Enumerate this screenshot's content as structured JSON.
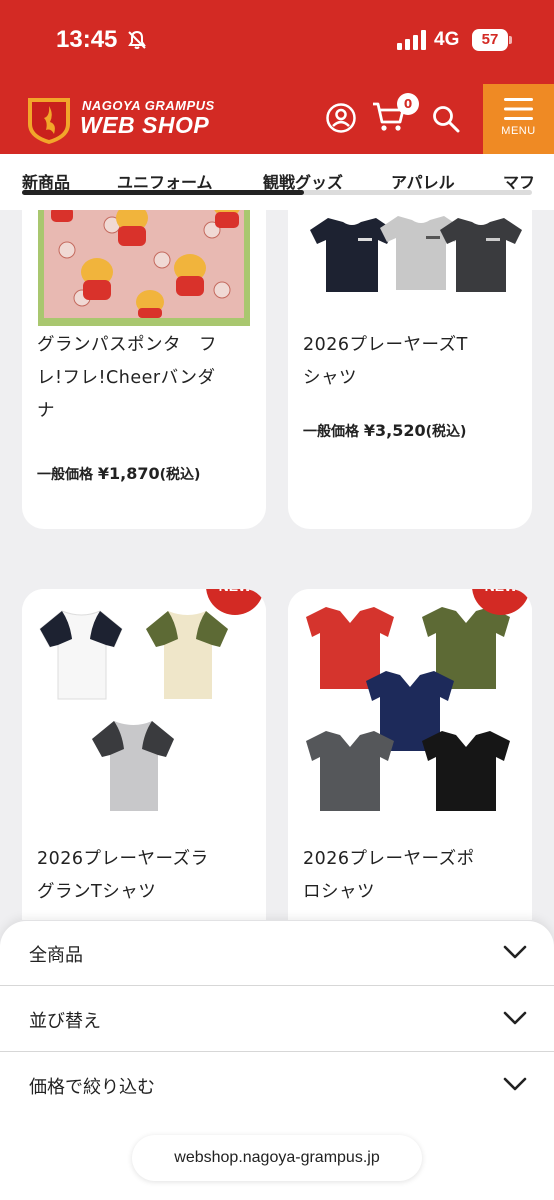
{
  "status_bar": {
    "time": "13:45",
    "network": "4G",
    "battery": "57"
  },
  "header": {
    "brand_top": "NAGOYA GRAMPUS",
    "brand_bottom": "WEB SHOP",
    "cart_count": "0",
    "menu_label": "MENU",
    "accent": "#d32a24",
    "menu_color": "#ef8a24"
  },
  "tabs": [
    {
      "label": "新商品"
    },
    {
      "label": "ユニフォーム"
    },
    {
      "label": "観戦グッズ"
    },
    {
      "label": "アパレル"
    },
    {
      "label": "マフ"
    }
  ],
  "products": [
    {
      "name_line1": "グランパスポンタ　フ",
      "name_line2": "レ!フレ!Cheerバンダ",
      "name_line3": "ナ",
      "price_label": "一般価格",
      "price": "¥1,870",
      "tax": "(税込)",
      "is_new": false
    },
    {
      "name_line1": "2026プレーヤーズT",
      "name_line2": "シャツ",
      "price_label": "一般価格",
      "price": "¥3,520",
      "tax": "(税込)",
      "is_new": false
    },
    {
      "name_line1": "2026プレーヤーズラ",
      "name_line2": "グランTシャツ",
      "badge": "NEW",
      "is_new": true
    },
    {
      "name_line1": "2026プレーヤーズポ",
      "name_line2": "ロシャツ",
      "badge": "NEW",
      "is_new": true
    }
  ],
  "filters": [
    {
      "label": "全商品"
    },
    {
      "label": "並び替え"
    },
    {
      "label": "価格で絞り込む"
    }
  ],
  "url": "webshop.nagoya-grampus.jp"
}
